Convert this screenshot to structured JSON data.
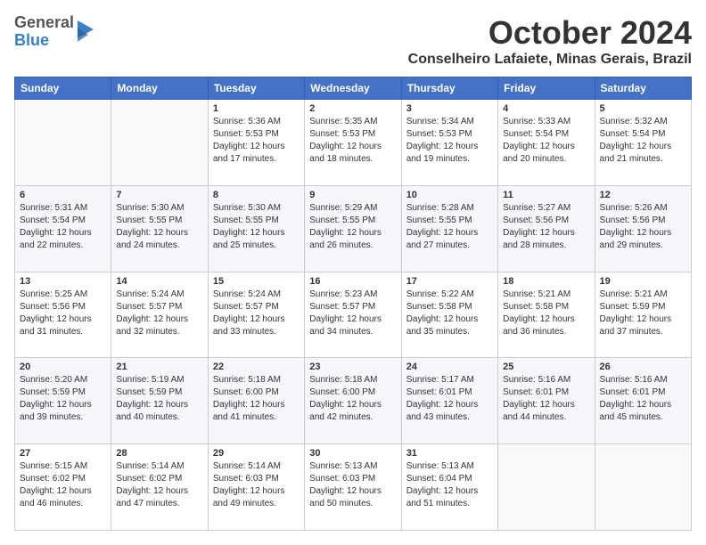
{
  "header": {
    "logo": {
      "general": "General",
      "blue": "Blue"
    },
    "title": "October 2024",
    "location": "Conselheiro Lafaiete, Minas Gerais, Brazil"
  },
  "weekdays": [
    "Sunday",
    "Monday",
    "Tuesday",
    "Wednesday",
    "Thursday",
    "Friday",
    "Saturday"
  ],
  "weeks": [
    [
      {
        "day": "",
        "info": ""
      },
      {
        "day": "",
        "info": ""
      },
      {
        "day": "1",
        "info": "Sunrise: 5:36 AM\nSunset: 5:53 PM\nDaylight: 12 hours and 17 minutes."
      },
      {
        "day": "2",
        "info": "Sunrise: 5:35 AM\nSunset: 5:53 PM\nDaylight: 12 hours and 18 minutes."
      },
      {
        "day": "3",
        "info": "Sunrise: 5:34 AM\nSunset: 5:53 PM\nDaylight: 12 hours and 19 minutes."
      },
      {
        "day": "4",
        "info": "Sunrise: 5:33 AM\nSunset: 5:54 PM\nDaylight: 12 hours and 20 minutes."
      },
      {
        "day": "5",
        "info": "Sunrise: 5:32 AM\nSunset: 5:54 PM\nDaylight: 12 hours and 21 minutes."
      }
    ],
    [
      {
        "day": "6",
        "info": "Sunrise: 5:31 AM\nSunset: 5:54 PM\nDaylight: 12 hours and 22 minutes."
      },
      {
        "day": "7",
        "info": "Sunrise: 5:30 AM\nSunset: 5:55 PM\nDaylight: 12 hours and 24 minutes."
      },
      {
        "day": "8",
        "info": "Sunrise: 5:30 AM\nSunset: 5:55 PM\nDaylight: 12 hours and 25 minutes."
      },
      {
        "day": "9",
        "info": "Sunrise: 5:29 AM\nSunset: 5:55 PM\nDaylight: 12 hours and 26 minutes."
      },
      {
        "day": "10",
        "info": "Sunrise: 5:28 AM\nSunset: 5:55 PM\nDaylight: 12 hours and 27 minutes."
      },
      {
        "day": "11",
        "info": "Sunrise: 5:27 AM\nSunset: 5:56 PM\nDaylight: 12 hours and 28 minutes."
      },
      {
        "day": "12",
        "info": "Sunrise: 5:26 AM\nSunset: 5:56 PM\nDaylight: 12 hours and 29 minutes."
      }
    ],
    [
      {
        "day": "13",
        "info": "Sunrise: 5:25 AM\nSunset: 5:56 PM\nDaylight: 12 hours and 31 minutes."
      },
      {
        "day": "14",
        "info": "Sunrise: 5:24 AM\nSunset: 5:57 PM\nDaylight: 12 hours and 32 minutes."
      },
      {
        "day": "15",
        "info": "Sunrise: 5:24 AM\nSunset: 5:57 PM\nDaylight: 12 hours and 33 minutes."
      },
      {
        "day": "16",
        "info": "Sunrise: 5:23 AM\nSunset: 5:57 PM\nDaylight: 12 hours and 34 minutes."
      },
      {
        "day": "17",
        "info": "Sunrise: 5:22 AM\nSunset: 5:58 PM\nDaylight: 12 hours and 35 minutes."
      },
      {
        "day": "18",
        "info": "Sunrise: 5:21 AM\nSunset: 5:58 PM\nDaylight: 12 hours and 36 minutes."
      },
      {
        "day": "19",
        "info": "Sunrise: 5:21 AM\nSunset: 5:59 PM\nDaylight: 12 hours and 37 minutes."
      }
    ],
    [
      {
        "day": "20",
        "info": "Sunrise: 5:20 AM\nSunset: 5:59 PM\nDaylight: 12 hours and 39 minutes."
      },
      {
        "day": "21",
        "info": "Sunrise: 5:19 AM\nSunset: 5:59 PM\nDaylight: 12 hours and 40 minutes."
      },
      {
        "day": "22",
        "info": "Sunrise: 5:18 AM\nSunset: 6:00 PM\nDaylight: 12 hours and 41 minutes."
      },
      {
        "day": "23",
        "info": "Sunrise: 5:18 AM\nSunset: 6:00 PM\nDaylight: 12 hours and 42 minutes."
      },
      {
        "day": "24",
        "info": "Sunrise: 5:17 AM\nSunset: 6:01 PM\nDaylight: 12 hours and 43 minutes."
      },
      {
        "day": "25",
        "info": "Sunrise: 5:16 AM\nSunset: 6:01 PM\nDaylight: 12 hours and 44 minutes."
      },
      {
        "day": "26",
        "info": "Sunrise: 5:16 AM\nSunset: 6:01 PM\nDaylight: 12 hours and 45 minutes."
      }
    ],
    [
      {
        "day": "27",
        "info": "Sunrise: 5:15 AM\nSunset: 6:02 PM\nDaylight: 12 hours and 46 minutes."
      },
      {
        "day": "28",
        "info": "Sunrise: 5:14 AM\nSunset: 6:02 PM\nDaylight: 12 hours and 47 minutes."
      },
      {
        "day": "29",
        "info": "Sunrise: 5:14 AM\nSunset: 6:03 PM\nDaylight: 12 hours and 49 minutes."
      },
      {
        "day": "30",
        "info": "Sunrise: 5:13 AM\nSunset: 6:03 PM\nDaylight: 12 hours and 50 minutes."
      },
      {
        "day": "31",
        "info": "Sunrise: 5:13 AM\nSunset: 6:04 PM\nDaylight: 12 hours and 51 minutes."
      },
      {
        "day": "",
        "info": ""
      },
      {
        "day": "",
        "info": ""
      }
    ]
  ]
}
